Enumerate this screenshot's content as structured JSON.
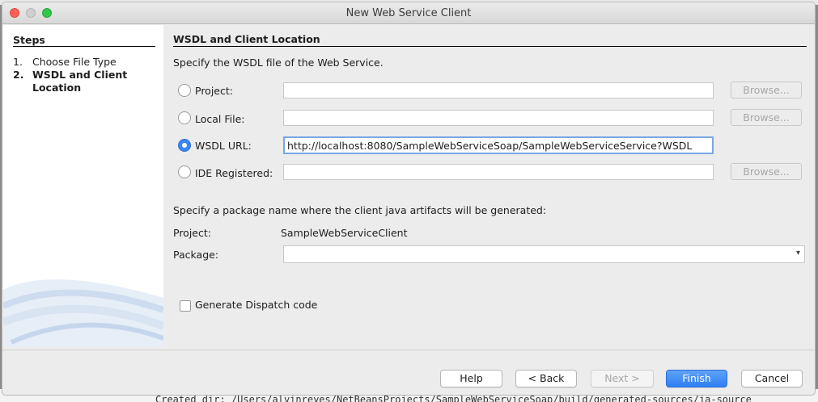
{
  "window": {
    "title": "New Web Service Client"
  },
  "steps": {
    "heading": "Steps",
    "items": [
      {
        "num": "1.",
        "label": "Choose File Type"
      },
      {
        "num": "2.",
        "label": "WSDL and Client Location"
      }
    ]
  },
  "main": {
    "header": "WSDL and Client Location",
    "wsdl_instruction": "Specify the WSDL file of the Web Service.",
    "sources": [
      {
        "label": "Project:",
        "value": "",
        "browse": "Browse..."
      },
      {
        "label": "Local File:",
        "value": "",
        "browse": "Browse..."
      },
      {
        "label": "WSDL URL:",
        "value": "http://localhost:8080/SampleWebServiceSoap/SampleWebServiceService?WSDL"
      },
      {
        "label": "IDE Registered:",
        "value": "",
        "browse": "Browse..."
      }
    ],
    "selected_source": "WSDL URL:",
    "package_instruction": "Specify a package name where the client java artifacts will be generated:",
    "project_label": "Project:",
    "project_value": "SampleWebServiceClient",
    "package_label": "Package:",
    "package_value": "",
    "dispatch_label": "Generate Dispatch code",
    "dispatch_checked": false
  },
  "buttons": {
    "help": "Help",
    "back": "< Back",
    "next": "Next >",
    "finish": "Finish",
    "cancel": "Cancel"
  },
  "background": {
    "console_text": "Created dir: /Users/alvinreyes/NetBeansProjects/SampleWebServiceSoap/build/generated-sources/ja-source"
  },
  "colors": {
    "accent": "#3b86f5"
  }
}
